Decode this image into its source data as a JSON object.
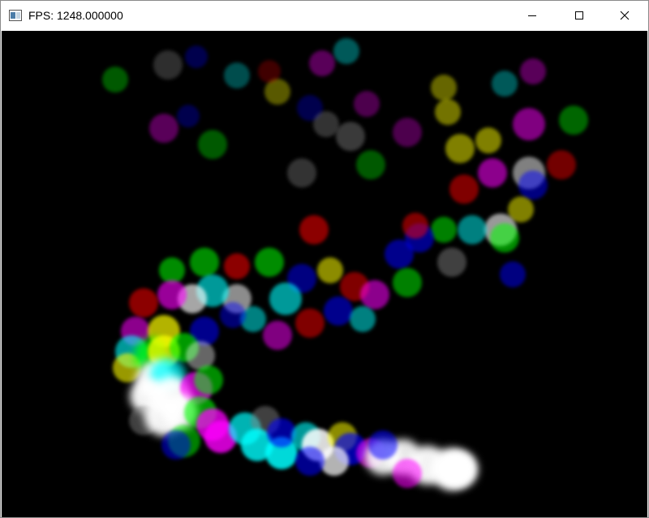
{
  "window": {
    "title": "FPS: 1248.000000",
    "icon": "app-window-icon",
    "caption_buttons": [
      "minimize-icon",
      "maximize-icon",
      "close-icon"
    ]
  },
  "canvas": {
    "background": "#000000",
    "content": "particle-trail",
    "palette": [
      "#ff0000",
      "#00ff00",
      "#0000ff",
      "#ffff00",
      "#ff00ff",
      "#00ffff",
      "#ffffff",
      "#808080"
    ]
  }
}
